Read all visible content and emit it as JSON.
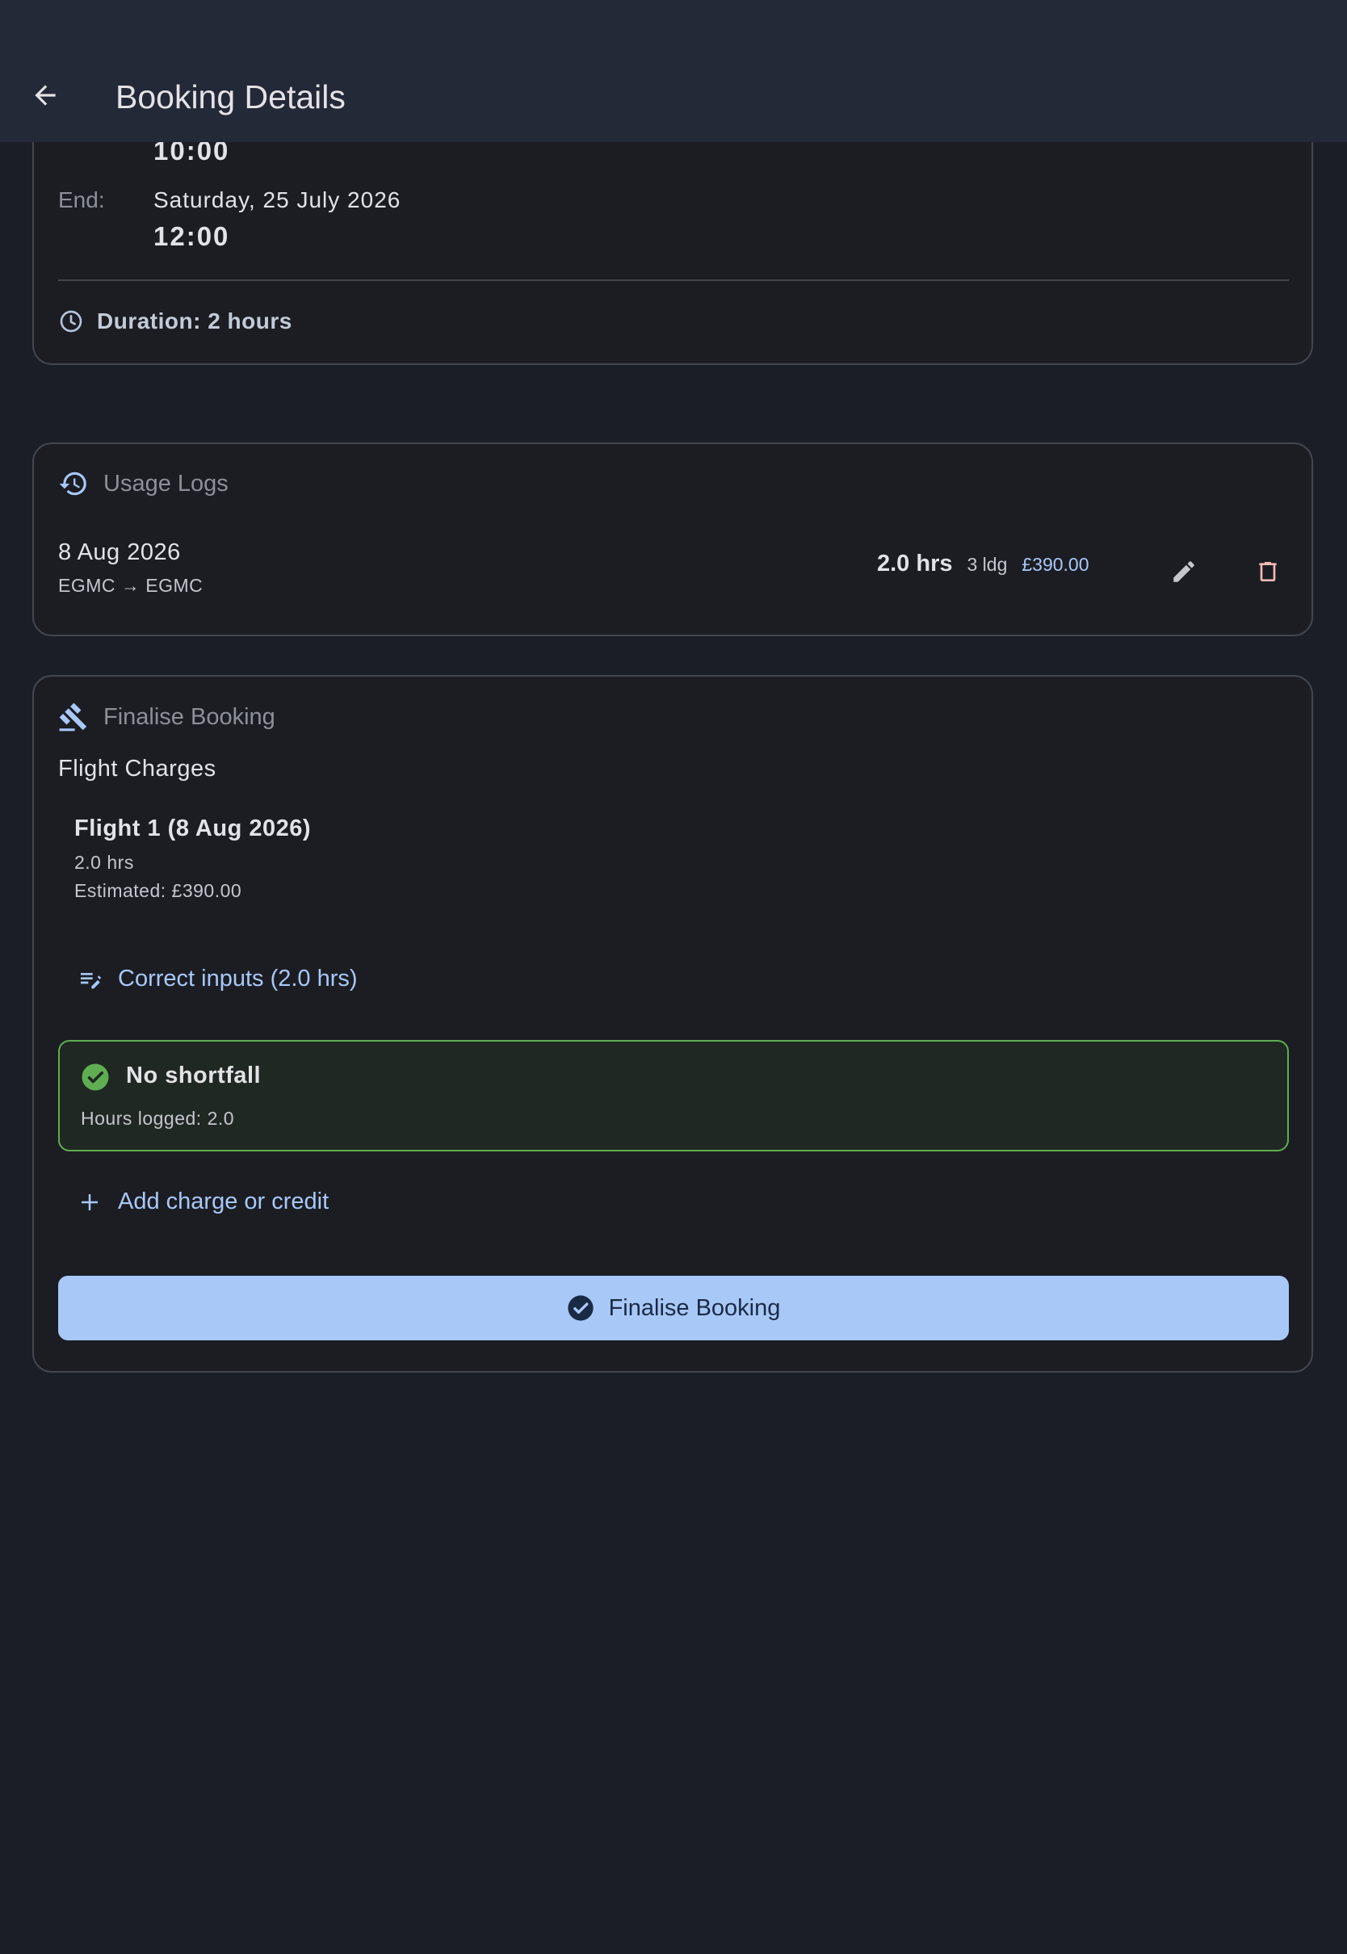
{
  "appbar": {
    "title": "Booking Details"
  },
  "schedule": {
    "start_time": "10:00",
    "end_label": "End:",
    "end_date": "Saturday, 25 July 2026",
    "end_time": "12:00",
    "duration": "Duration: 2 hours"
  },
  "usage_logs": {
    "title": "Usage Logs",
    "entries": [
      {
        "date": "8 Aug 2026",
        "route": "EGMC → EGMC",
        "hours": "2.0 hrs",
        "landings": "3 ldg",
        "cost": "£390.00"
      }
    ]
  },
  "finalise": {
    "title": "Finalise Booking",
    "section_label": "Flight Charges",
    "flights": [
      {
        "title": "Flight 1 (8 Aug 2026)",
        "hours": "2.0 hrs",
        "estimate": "Estimated: £390.00"
      }
    ],
    "correct_inputs_label": "Correct inputs (2.0 hrs)",
    "status": {
      "title": "No shortfall",
      "detail": "Hours logged: 2.0"
    },
    "add_charge_label": "Add charge or credit",
    "button_label": "Finalise Booking"
  },
  "colors": {
    "background": "#1b1e27",
    "appbar": "#242938",
    "accent": "#a8c8f8",
    "success": "#5fae52",
    "danger": "#f2b8b5"
  }
}
